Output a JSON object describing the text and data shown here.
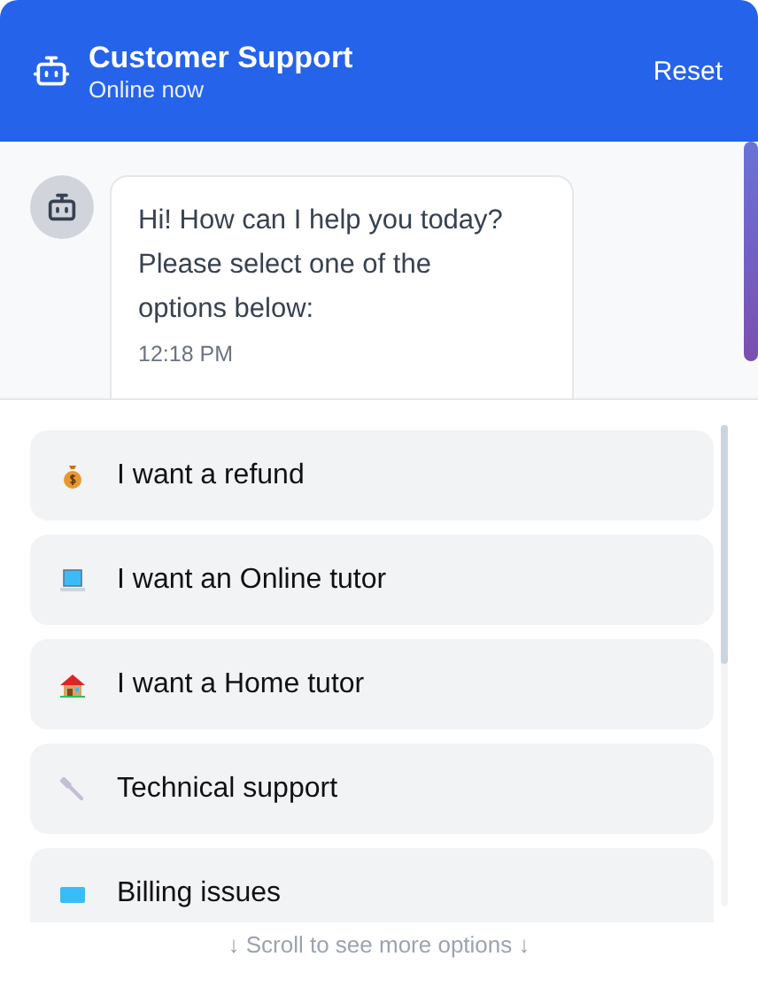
{
  "header": {
    "title": "Customer Support",
    "status": "Online now",
    "action": "Reset"
  },
  "messages": [
    {
      "text": "Hi! How can I help you today? Please select one of the options below:",
      "time": "12:18 PM"
    }
  ],
  "options": [
    {
      "kind": "money",
      "label": "I want a refund"
    },
    {
      "kind": "laptop",
      "label": "I want an Online tutor"
    },
    {
      "kind": "house",
      "label": "I want a Home tutor"
    },
    {
      "kind": "wrench",
      "label": "Technical support"
    },
    {
      "kind": "card",
      "label": "Billing issues"
    }
  ],
  "hint": "↓ Scroll to see more options ↓"
}
